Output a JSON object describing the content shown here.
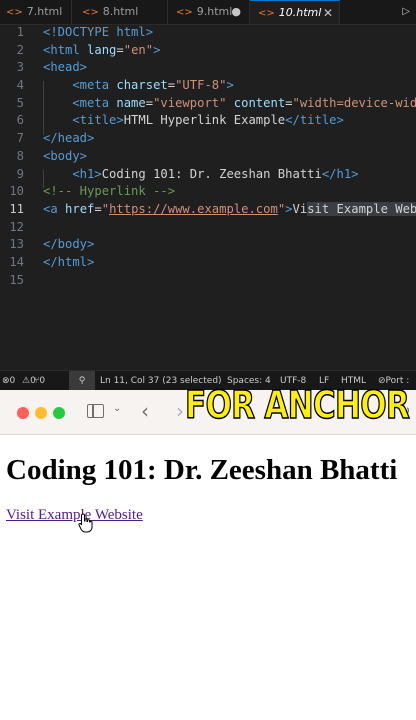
{
  "editor": {
    "tabs": [
      {
        "label": "7.html"
      },
      {
        "label": "8.html"
      },
      {
        "label": "9.html",
        "dirty": true
      },
      {
        "label": "10.html",
        "active": true
      }
    ],
    "lines": [
      {
        "n": "1",
        "tokens": [
          [
            "<!DOCTYPE html>",
            "tag"
          ]
        ]
      },
      {
        "n": "2",
        "tokens": [
          [
            "<",
            "tag"
          ],
          [
            "html",
            "tag"
          ],
          [
            " lang",
            "attr"
          ],
          [
            "=",
            "txt"
          ],
          [
            "\"en\"",
            "val"
          ],
          [
            ">",
            "tag"
          ]
        ]
      },
      {
        "n": "3",
        "tokens": [
          [
            "<head>",
            "tag"
          ]
        ]
      },
      {
        "n": "4",
        "tokens": [
          [
            "    <meta",
            "tag"
          ],
          [
            " charset",
            "attr"
          ],
          [
            "=",
            "txt"
          ],
          [
            "\"UTF-8\"",
            "val"
          ],
          [
            ">",
            "tag"
          ]
        ]
      },
      {
        "n": "5",
        "tokens": [
          [
            "    <meta",
            "tag"
          ],
          [
            " name",
            "attr"
          ],
          [
            "=",
            "txt"
          ],
          [
            "\"viewport\"",
            "val"
          ],
          [
            " content",
            "attr"
          ],
          [
            "=",
            "txt"
          ],
          [
            "\"width=device-width",
            "val"
          ]
        ]
      },
      {
        "n": "6",
        "tokens": [
          [
            "    <title>",
            "tag"
          ],
          [
            "HTML Hyperlink Example",
            "txt"
          ],
          [
            "</title>",
            "tag"
          ]
        ]
      },
      {
        "n": "7",
        "tokens": [
          [
            "</head>",
            "tag"
          ]
        ]
      },
      {
        "n": "8",
        "tokens": [
          [
            "<body>",
            "tag"
          ]
        ]
      },
      {
        "n": "9",
        "tokens": [
          [
            "    <h1>",
            "tag"
          ],
          [
            "Coding 101: Dr. Zeeshan Bhatti",
            "txt"
          ],
          [
            "</h1>",
            "tag"
          ]
        ]
      },
      {
        "n": "10",
        "tokens": [
          [
            "<!-- Hyperlink -->",
            "com"
          ]
        ]
      },
      {
        "n": "11",
        "tokens": [
          [
            "<a",
            "tag"
          ],
          [
            " href",
            "attr"
          ],
          [
            "=",
            "txt"
          ],
          [
            "\"",
            "val"
          ],
          [
            "https://www.example.com",
            "link"
          ],
          [
            "\"",
            "val"
          ],
          [
            ">",
            "tag"
          ],
          [
            "Vi",
            "txt"
          ],
          [
            "sit Example Websi",
            "sel"
          ]
        ],
        "current": true
      },
      {
        "n": "12",
        "tokens": []
      },
      {
        "n": "13",
        "tokens": [
          [
            "</body>",
            "tag"
          ]
        ]
      },
      {
        "n": "14",
        "tokens": [
          [
            "</html>",
            "tag"
          ]
        ]
      },
      {
        "n": "15",
        "tokens": []
      }
    ],
    "status": {
      "errors": "0",
      "warnings": "0",
      "ports": "0",
      "position": "Ln 11, Col 37 (23 selected)",
      "spaces": "Spaces: 4",
      "encoding": "UTF-8",
      "eol": "LF",
      "language": "HTML",
      "port": "Port :"
    }
  },
  "browser": {
    "heading": "Coding 101: Dr. Zeeshan Bhatti",
    "link_text": "Visit Example Website"
  },
  "overlay": {
    "caption": "FOR ANCHOR"
  },
  "colors": {
    "editor_bg": "#1f1f1f",
    "tag": "#569cd6",
    "attr": "#9cdcfe",
    "value": "#ce9178",
    "comment": "#6a9955",
    "link_visited": "#551a8b",
    "caption": "#ffef00"
  }
}
